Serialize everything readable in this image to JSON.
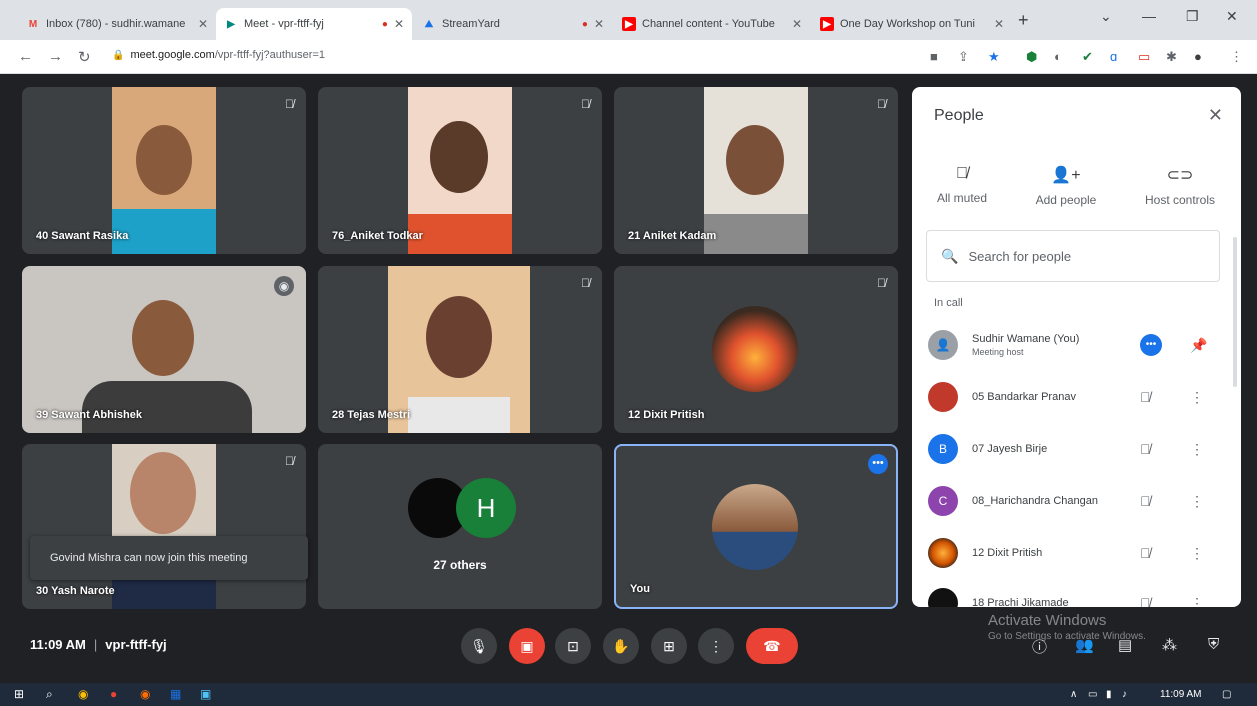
{
  "browser": {
    "tabs": [
      {
        "label": "Inbox (780) - sudhir.wamane",
        "icon": "gmail-icon",
        "color": "#ea4335"
      },
      {
        "label": "Meet - vpr-ftff-fyj",
        "icon": "meet-icon",
        "color": "#00897b"
      },
      {
        "label": "StreamYard",
        "icon": "streamyard-icon",
        "color": "#1a73e8"
      },
      {
        "label": "Channel content - YouTube",
        "icon": "youtube-icon",
        "color": "#ff0000"
      },
      {
        "label": "One Day Workshop on Tuni",
        "icon": "youtube-icon",
        "color": "#ff0000"
      }
    ],
    "url_host": "meet.google.com",
    "url_path": "/vpr-ftff-fyj?authuser=1"
  },
  "tiles": [
    {
      "name": "40 Sawant Rasika",
      "bg": "#d9a87a",
      "shirt": "#1da1c8"
    },
    {
      "name": "76_Aniket Todkar",
      "bg": "#f2d8c9",
      "shirt": "#e0522e"
    },
    {
      "name": "21 Aniket Kadam",
      "bg": "#e6e1d8",
      "shirt": "#8a8a8a"
    },
    {
      "name": "39 Sawant Abhishek",
      "bg": "#c9c6c1",
      "shirt": "#3c3c3c"
    },
    {
      "name": "28 Tejas Mestri",
      "bg": "#e8c49a",
      "shirt": "#e8e8e8"
    },
    {
      "name": "12 Dixit Pritish",
      "bg": "#3c4043",
      "shirt": "#e0522e"
    },
    {
      "name": "30 Yash Narote",
      "bg": "#d8cfc2",
      "shirt": "#1f2a44"
    },
    {
      "name": "27 others",
      "bg": "#3c4043",
      "shirt": "#188038"
    },
    {
      "name": "You",
      "bg": "#3c4043",
      "shirt": "#2a4d7e"
    }
  ],
  "others_avatar_letter": "H",
  "toast": "Govind Mishra can now join this meeting",
  "meeting": {
    "time": "11:09 AM",
    "code": "vpr-ftff-fyj"
  },
  "people": {
    "title": "People",
    "actions": [
      {
        "label": "All muted",
        "icon": "mic-off-icon"
      },
      {
        "label": "Add people",
        "icon": "add-person-icon"
      },
      {
        "label": "Host controls",
        "icon": "toggle-icon"
      }
    ],
    "search_placeholder": "Search for people",
    "section": "In call",
    "participants": [
      {
        "name": "Sudhir Wamane (You)",
        "sub": "Meeting host",
        "avatar": "",
        "color": "#9aa0a6"
      },
      {
        "name": "05 Bandarkar Pranav",
        "sub": "",
        "avatar": "",
        "color": "#c0392b"
      },
      {
        "name": "07 Jayesh Birje",
        "sub": "",
        "avatar": "B",
        "color": "#1a73e8"
      },
      {
        "name": "08_Harichandra Changan",
        "sub": "",
        "avatar": "C",
        "color": "#8e44ad"
      },
      {
        "name": "12 Dixit Pritish",
        "sub": "",
        "avatar": "",
        "color": "#d35400"
      },
      {
        "name": "18 Prachi Jikamade",
        "sub": "",
        "avatar": "",
        "color": "#111111"
      }
    ]
  },
  "watermark": {
    "title": "Activate Windows",
    "sub": "Go to Settings to activate Windows."
  },
  "taskbar": {
    "clock": "11:09 AM"
  }
}
